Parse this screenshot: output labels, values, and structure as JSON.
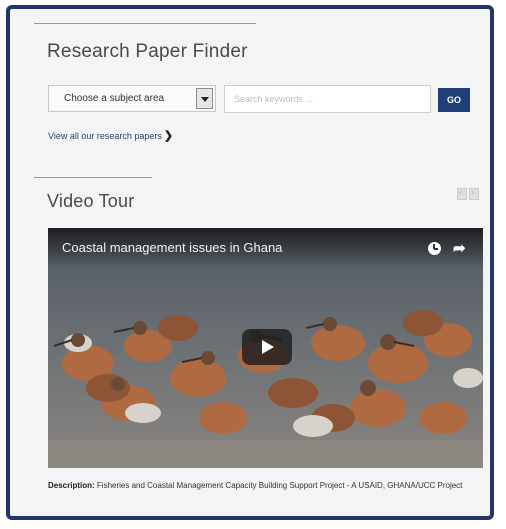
{
  "research_finder": {
    "title": "Research Paper Finder",
    "subject_select": {
      "selected": "Choose a subject area"
    },
    "search": {
      "placeholder": "Search keywords ...",
      "value": ""
    },
    "go_label": "GO",
    "view_all_label": "View all our research papers",
    "view_all_chevron": "❯"
  },
  "video_tour": {
    "title": "Video Tour",
    "video": {
      "title": "Coastal management issues in Ghana",
      "icons": [
        "clock-icon",
        "share-icon",
        "play-icon"
      ]
    },
    "description_label": "Description:",
    "description_text": "Fisheries and Coastal Management Capacity Building Support Project - A USAID, GHANA/UCC Project"
  },
  "colors": {
    "frame_border": "#24356a",
    "go_button": "#1f3f76",
    "panel_bg": "#f4f4f4"
  }
}
